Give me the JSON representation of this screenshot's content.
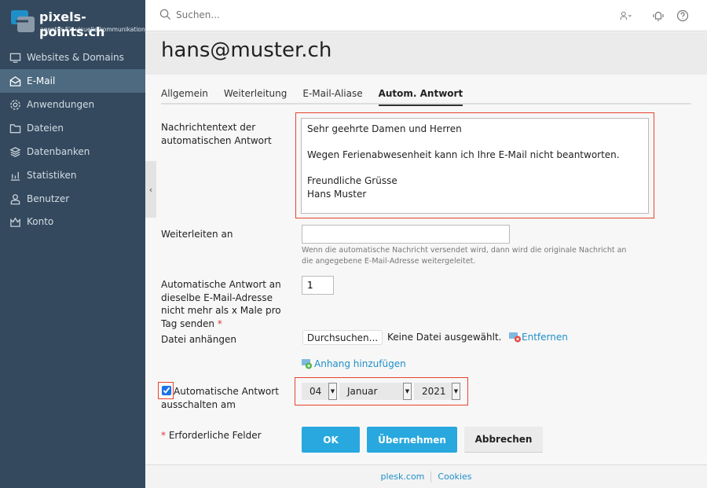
{
  "brand": {
    "name": "pixels-points.ch",
    "tagline": "agentur für visuelle kommunikation",
    "logo_color": "#1f8fc9"
  },
  "sidebar": {
    "items": [
      {
        "label": "Websites & Domains",
        "icon": "monitor-icon"
      },
      {
        "label": "E-Mail",
        "icon": "envelope-open-icon",
        "active": true
      },
      {
        "label": "Anwendungen",
        "icon": "gear-icon"
      },
      {
        "label": "Dateien",
        "icon": "folder-icon"
      },
      {
        "label": "Datenbanken",
        "icon": "layers-icon"
      },
      {
        "label": "Statistiken",
        "icon": "bar-chart-icon"
      },
      {
        "label": "Benutzer",
        "icon": "user-icon"
      },
      {
        "label": "Konto",
        "icon": "crown-icon"
      }
    ],
    "collapse_icon": "‹"
  },
  "topbar": {
    "search_placeholder": "Suchen..."
  },
  "page": {
    "title": "hans@muster.ch"
  },
  "tabs": [
    {
      "label": "Allgemein"
    },
    {
      "label": "Weiterleitung"
    },
    {
      "label": "E-Mail-Aliase"
    },
    {
      "label": "Autom. Antwort",
      "active": true
    }
  ],
  "form": {
    "message_label": "Nachrichtentext der automatischen Antwort",
    "message_value": "Sehr geehrte Damen und Herren\n\nWegen Ferienabwesenheit kann ich Ihre E-Mail nicht beantworten.\n\nFreundliche Grüsse\nHans Muster",
    "forward_label": "Weiterleiten an",
    "forward_value": "",
    "forward_hint": "Wenn die automatische Nachricht versendet wird, dann wird die originale Nachricht an die angegebene E-Mail-Adresse weitergeleitet.",
    "max_label": "Automatische Antwort an dieselbe E-Mail-Adresse nicht mehr als x Male pro Tag senden",
    "max_value": "1",
    "required_mark": "*",
    "attach_label": "Datei anhängen",
    "browse_label": "Durchsuchen...",
    "no_file": "Keine Datei ausgewählt.",
    "remove_label": "Entfernen",
    "add_attachment_label": "Anhang hinzufügen",
    "disable_label": "Automatische Antwort ausschalten am",
    "disable_checked": true,
    "day": "04",
    "month": "Januar",
    "year": "2021",
    "required_note": "Erforderliche Felder"
  },
  "buttons": {
    "ok": "OK",
    "apply": "Übernehmen",
    "cancel": "Abbrechen"
  },
  "footer": {
    "links": [
      "plesk.com",
      "Cookies"
    ]
  },
  "colors": {
    "sidebar": "#34495e",
    "active": "#4d6a80",
    "primary": "#28a8de",
    "highlight": "#e8442f"
  }
}
